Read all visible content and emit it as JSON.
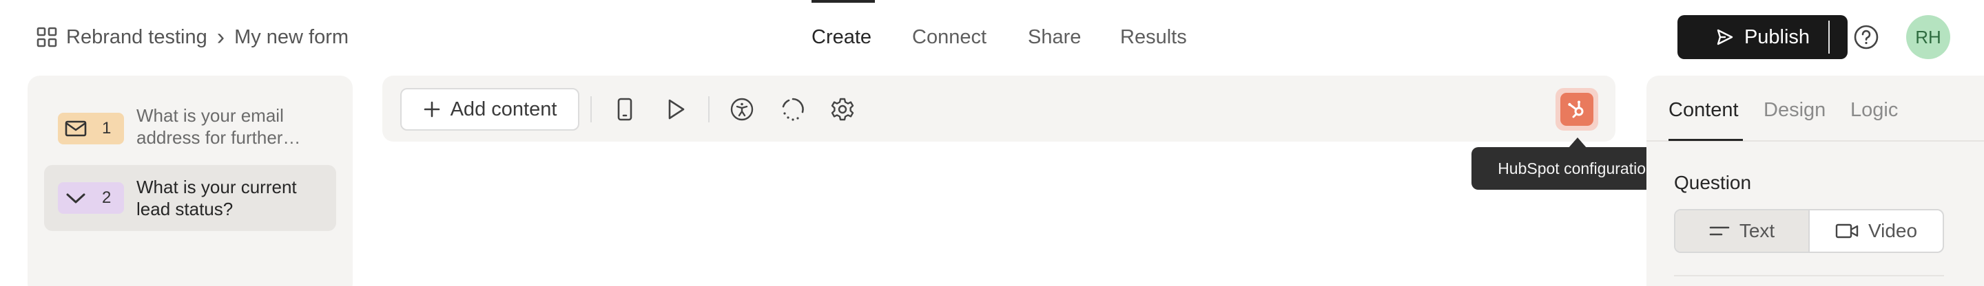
{
  "breadcrumb": {
    "workspace": "Rebrand testing",
    "separator": "›",
    "form": "My new form"
  },
  "nav": {
    "tabs": [
      "Create",
      "Connect",
      "Share",
      "Results"
    ],
    "active": "Create"
  },
  "header": {
    "publish_label": "Publish",
    "avatar_initials": "RH"
  },
  "questions": [
    {
      "number": "1",
      "text": "What is your email address for further…",
      "badge_color": "#f6d8ad",
      "icon": "mail-icon"
    },
    {
      "number": "2",
      "text": "What is your current lead status?",
      "badge_color": "#e4d3f0",
      "icon": "chevron-down-icon",
      "selected": true
    }
  ],
  "toolbar": {
    "add_content_label": "Add content"
  },
  "tooltip": {
    "text": "HubSpot configuration"
  },
  "right_panel": {
    "tabs": [
      "Content",
      "Design",
      "Logic"
    ],
    "active_tab": "Content",
    "question_label": "Question",
    "question_types": [
      "Text",
      "Video"
    ],
    "selected_type": "Text"
  },
  "colors": {
    "hubspot": "#e97a5d",
    "publish_bg": "#191919",
    "avatar_bg": "#b5e3c0"
  }
}
